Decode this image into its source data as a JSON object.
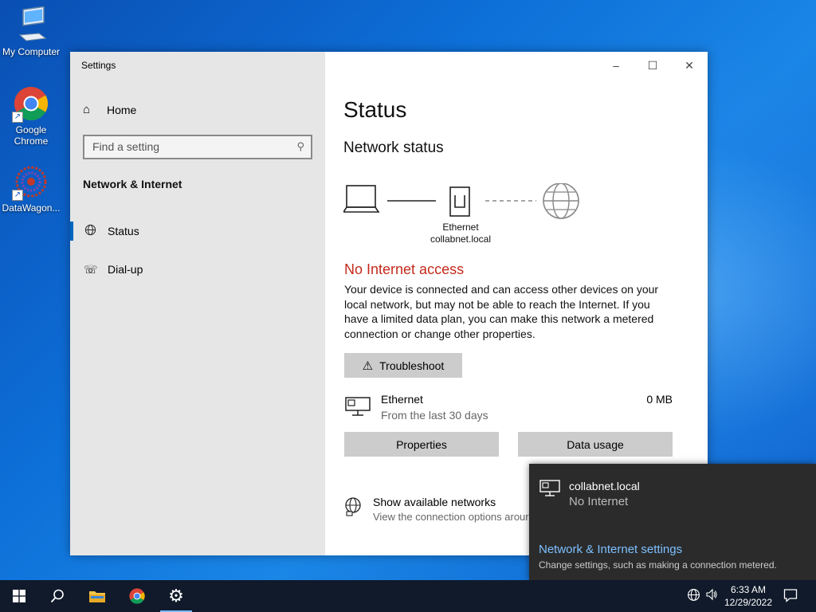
{
  "desktop": {
    "icons": [
      {
        "label": "My Computer"
      },
      {
        "label": "Google Chrome"
      },
      {
        "label": "DataWagon..."
      }
    ]
  },
  "window": {
    "title": "Settings",
    "controls": {
      "minimize": "–",
      "maximize": "☐",
      "close": "✕"
    }
  },
  "sidebar": {
    "home_label": "Home",
    "search_placeholder": "Find a setting",
    "section_title": "Network & Internet",
    "items": [
      {
        "label": "Status",
        "icon": "globe-icon",
        "active": true
      },
      {
        "label": "Dial-up",
        "icon": "dialup-icon",
        "active": false
      }
    ]
  },
  "main": {
    "title": "Status",
    "network_status_heading": "Network status",
    "diagram": {
      "adapter_name": "Ethernet",
      "network_name": "collabnet.local"
    },
    "alert": "No Internet access",
    "description": "Your device is connected and can access other devices on your local network, but may not be able to reach the Internet. If you have a limited data plan, you can make this network a metered connection or change other properties.",
    "troubleshoot_label": "Troubleshoot",
    "ethernet": {
      "name": "Ethernet",
      "subtitle": "From the last 30 days",
      "usage": "0 MB"
    },
    "properties_label": "Properties",
    "data_usage_label": "Data usage",
    "available": {
      "title": "Show available networks",
      "subtitle": "View the connection options arour"
    }
  },
  "flyout": {
    "network_name": "collabnet.local",
    "status": "No Internet",
    "settings_link": "Network & Internet settings",
    "settings_desc": "Change settings, such as making a connection metered."
  },
  "taskbar": {
    "clock_time": "6:33 AM",
    "clock_date": "12/29/2022"
  },
  "colors": {
    "alert": "#c42b1c",
    "accent": "#0067c0",
    "link": "#7cc0ff"
  }
}
